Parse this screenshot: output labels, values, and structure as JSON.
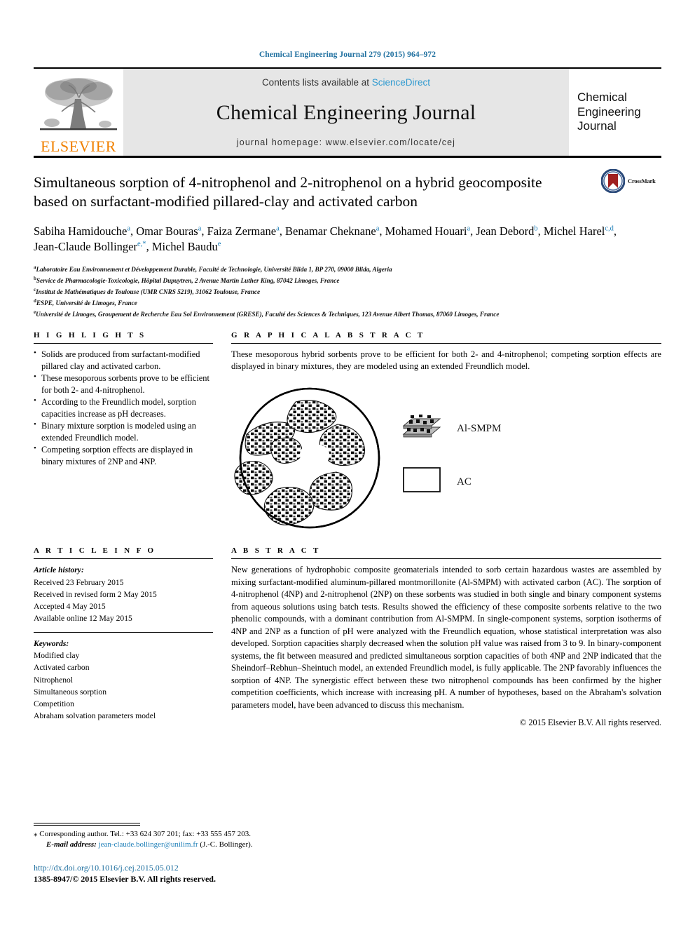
{
  "running_head": "Chemical Engineering Journal 279 (2015) 964–972",
  "masthead": {
    "contents_prefix": "Contents lists available at ",
    "sciencedirect": "ScienceDirect",
    "journal_title": "Chemical Engineering Journal",
    "homepage": "journal homepage: www.elsevier.com/locate/cej",
    "publisher": "ELSEVIER",
    "cover_lines": [
      "Chemical",
      "Engineering",
      "Journal"
    ],
    "logo_icon": "elsevier-tree-logo"
  },
  "crossmark": {
    "label": "CrossMark",
    "icon": "crossmark-icon",
    "ring_color": "#2b4a7a",
    "mark_color": "#a02020"
  },
  "article": {
    "title": "Simultaneous sorption of 4-nitrophenol and 2-nitrophenol on a hybrid geocomposite based on surfactant-modified pillared-clay and activated carbon",
    "authors": [
      {
        "name": "Sabiha Hamidouche",
        "sup": "a",
        "sep": ", "
      },
      {
        "name": "Omar Bouras",
        "sup": "a",
        "sep": ", "
      },
      {
        "name": "Faiza Zermane",
        "sup": "a",
        "sep": ", "
      },
      {
        "name": "Benamar Cheknane",
        "sup": "a",
        "sep": ", "
      },
      {
        "name": "Mohamed Houari",
        "sup": "a",
        "sep": ", "
      },
      {
        "name": "Jean Debord",
        "sup": "b",
        "sep": ", "
      },
      {
        "name": "Michel Harel",
        "sup": "c,d",
        "sep": ", "
      },
      {
        "name": "Jean-Claude Bollinger",
        "sup": "e,*",
        "sep": ", "
      },
      {
        "name": "Michel Baudu",
        "sup": "e",
        "sep": ""
      }
    ],
    "affiliations": [
      {
        "sup": "a",
        "text": "Laboratoire Eau Environnement et Développement Durable, Faculté de Technologie, Université Blida 1, BP 270, 09000 Blida, Algeria"
      },
      {
        "sup": "b",
        "text": "Service de Pharmacologie-Toxicologie, Hôpital Dupuytren, 2 Avenue Martin Luther King, 87042 Limoges, France"
      },
      {
        "sup": "c",
        "text": "Institut de Mathématiques de Toulouse (UMR CNRS 5219), 31062 Toulouse, France"
      },
      {
        "sup": "d",
        "text": "ESPE, Université de Limoges, France"
      },
      {
        "sup": "e",
        "text": "Université de Limoges, Groupement de Recherche Eau Sol Environnement (GRESE), Faculté des Sciences & Techniques, 123 Avenue Albert Thomas, 87060 Limoges, France"
      }
    ]
  },
  "highlights": {
    "heading": "H I G H L I G H T S",
    "items": [
      "Solids are produced from surfactant-modified pillared clay and activated carbon.",
      "These mesoporous sorbents prove to be efficient for both 2- and 4-nitrophenol.",
      "According to the Freundlich model, sorption capacities increase as pH decreases.",
      "Binary mixture sorption is modeled using an extended Freundlich model.",
      "Competing sorption effects are displayed in binary mixtures of 2NP and 4NP."
    ]
  },
  "graphical_abstract": {
    "heading": "G R A P H I C A L   A B S T R A C T",
    "text": "These mesoporous hybrid sorbents prove to be efficient for both 2- and 4-nitrophenol; competing sorption effects are displayed in binary mixtures, they are modeled using an extended Freundlich model.",
    "legend": [
      {
        "icon": "layered-clay-stack-icon",
        "label": "Al-SMPM"
      },
      {
        "icon": "white-rectangle-icon",
        "label": "AC"
      }
    ],
    "figure_icon": "porous-composite-circle-diagram"
  },
  "article_info": {
    "heading": "A R T I C L E   I N F O",
    "history_label": "Article history:",
    "history": [
      "Received 23 February 2015",
      "Received in revised form 2 May 2015",
      "Accepted 4 May 2015",
      "Available online 12 May 2015"
    ],
    "keywords_label": "Keywords:",
    "keywords": [
      "Modified clay",
      "Activated carbon",
      "Nitrophenol",
      "Simultaneous sorption",
      "Competition",
      "Abraham solvation parameters model"
    ]
  },
  "abstract": {
    "heading": "A B S T R A C T",
    "text": "New generations of hydrophobic composite geomaterials intended to sorb certain hazardous wastes are assembled by mixing surfactant-modified aluminum-pillared montmorillonite (Al-SMPM) with activated carbon (AC). The sorption of 4-nitrophenol (4NP) and 2-nitrophenol (2NP) on these sorbents was studied in both single and binary component systems from aqueous solutions using batch tests. Results showed the efficiency of these composite sorbents relative to the two phenolic compounds, with a dominant contribution from Al-SMPM. In single-component systems, sorption isotherms of 4NP and 2NP as a function of pH were analyzed with the Freundlich equation, whose statistical interpretation was also developed. Sorption capacities sharply decreased when the solution pH value was raised from 3 to 9. In binary-component systems, the fit between measured and predicted simultaneous sorption capacities of both 4NP and 2NP indicated that the Sheindorf–Rebhun–Sheintuch model, an extended Freundlich model, is fully applicable. The 2NP favorably influences the sorption of 4NP. The synergistic effect between these two nitrophenol compounds has been confirmed by the higher competition coefficients, which increase with increasing pH. A number of hypotheses, based on the Abraham's solvation parameters model, have been advanced to discuss this mechanism.",
    "copyright": "© 2015 Elsevier B.V. All rights reserved."
  },
  "footer": {
    "corresponding": "Corresponding author. Tel.: +33 624 307 201; fax: +33 555 457 203.",
    "star": "⁎",
    "email_label": "E-mail address:",
    "email": "jean-claude.bollinger@unilim.fr",
    "email_owner": "(J.-C. Bollinger).",
    "doi": "http://dx.doi.org/10.1016/j.cej.2015.05.012",
    "issn": "1385-8947/© 2015 Elsevier B.V. All rights reserved."
  }
}
